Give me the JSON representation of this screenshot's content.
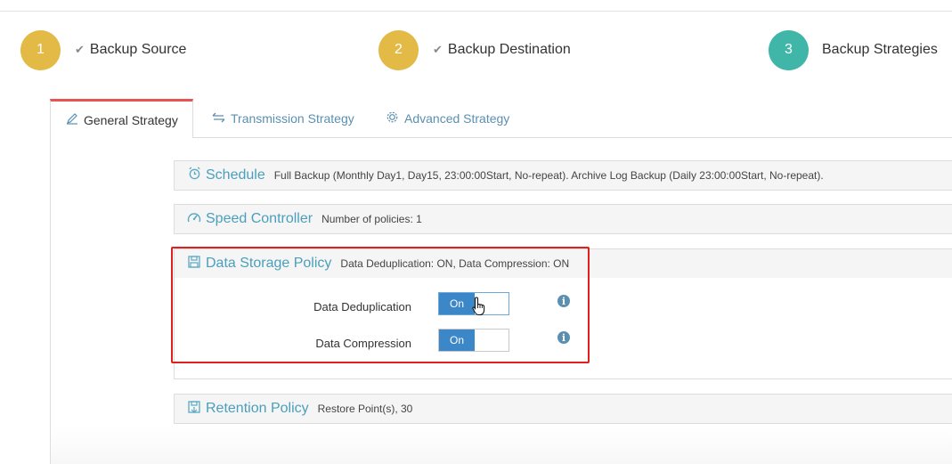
{
  "wizard": {
    "steps": [
      {
        "number": "1",
        "label": "Backup Source",
        "state": "done"
      },
      {
        "number": "2",
        "label": "Backup Destination",
        "state": "done"
      },
      {
        "number": "3",
        "label": "Backup Strategies",
        "state": "active"
      }
    ],
    "check_glyph": "✔"
  },
  "tabs": [
    {
      "label": "General Strategy",
      "icon": "edit-icon",
      "active": true
    },
    {
      "label": "Transmission Strategy",
      "icon": "transfer-arrows-icon",
      "active": false
    },
    {
      "label": "Advanced Strategy",
      "icon": "gear-icon",
      "active": false
    }
  ],
  "sections": {
    "schedule": {
      "title": "Schedule",
      "icon": "alarm-clock-icon",
      "description": "Full Backup (Monthly Day1, Day15, 23:00:00Start, No-repeat). Archive Log Backup (Daily 23:00:00Start, No-repeat)."
    },
    "speed": {
      "title": "Speed Controller",
      "icon": "speedometer-icon",
      "description": "Number of policies: 1"
    },
    "storage": {
      "title": "Data Storage Policy",
      "icon": "floppy-disk-icon",
      "description": "Data Deduplication: ON, Data Compression: ON",
      "fields": [
        {
          "label": "Data Deduplication",
          "toggle_label": "On",
          "value": true
        },
        {
          "label": "Data Compression",
          "toggle_label": "On",
          "value": true
        }
      ]
    },
    "retention": {
      "title": "Retention Policy",
      "icon": "floppy-save-icon",
      "description": "Restore Point(s), 30"
    }
  },
  "colors": {
    "step_done": "#e2ba45",
    "step_active": "#3fb6a8",
    "toggle_on": "#3b87c8",
    "section_title": "#4a9fbc",
    "highlight": "#e0201e",
    "active_tab_top": "#e55452"
  }
}
